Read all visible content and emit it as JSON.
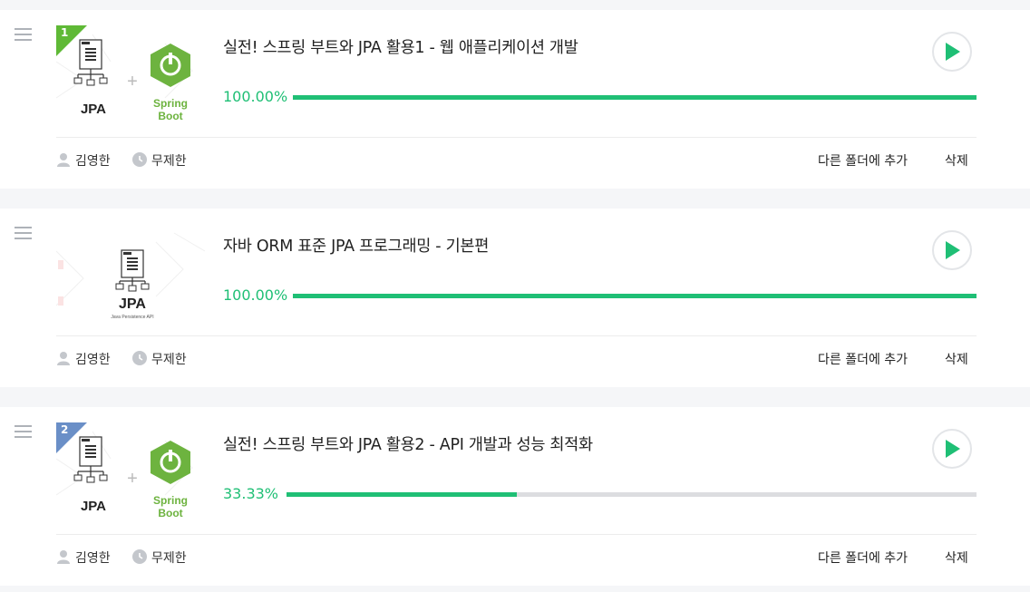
{
  "courses": [
    {
      "badge": "1",
      "badge_color": "#5fb936",
      "logo_text": "JPA",
      "spring_text_1": "Spring",
      "spring_text_2": "Boot",
      "title": "실전! 스프링 부트와 JPA 활용1 - 웹 애플리케이션 개발",
      "progress_label": "100.00%",
      "progress": 1.0,
      "instructor": "김영한",
      "duration": "무제한",
      "add_folder": "다른 폴더에 추가",
      "delete": "삭제"
    },
    {
      "logo_text": "JPA",
      "logo_subtext": "Java Persistence API",
      "title": "자바 ORM 표준 JPA 프로그래밍 - 기본편",
      "progress_label": "100.00%",
      "progress": 1.0,
      "instructor": "김영한",
      "duration": "무제한",
      "add_folder": "다른 폴더에 추가",
      "delete": "삭제"
    },
    {
      "badge": "2",
      "badge_color": "#6a8fc7",
      "logo_text": "JPA",
      "spring_text_1": "Spring",
      "spring_text_2": "Boot",
      "title": "실전! 스프링 부트와 JPA 활용2 - API 개발과 성능 최적화",
      "progress_label": "33.33%",
      "progress": 0.3333,
      "instructor": "김영한",
      "duration": "무제한",
      "add_folder": "다른 폴더에 추가",
      "delete": "삭제"
    }
  ],
  "colors": {
    "accent": "#1fbf75",
    "spring_green": "#6db33f"
  }
}
